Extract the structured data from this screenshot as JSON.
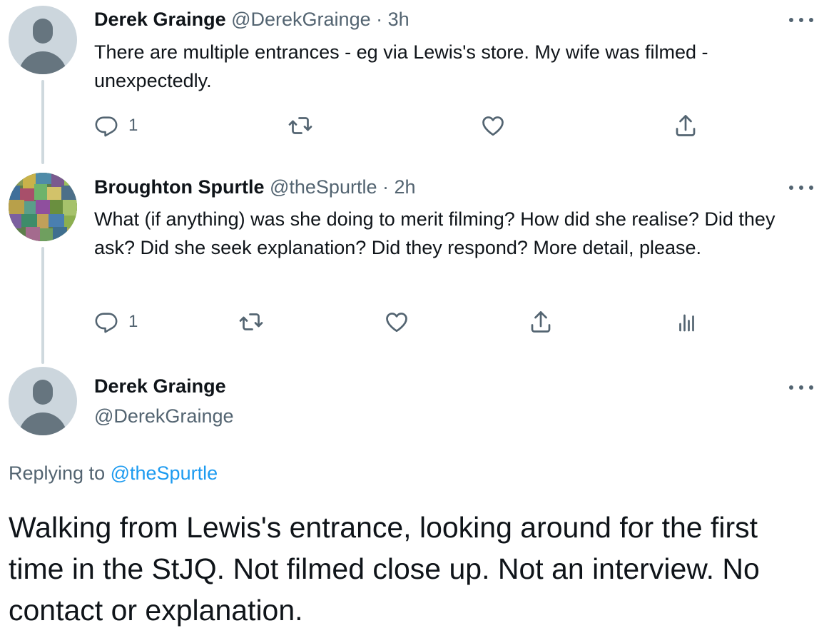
{
  "tweets": [
    {
      "author_name": "Derek Grainge",
      "handle": "@DerekGrainge",
      "separator": "·",
      "time": "3h",
      "text": "There are multiple entrances - eg via Lewis's store. My wife was filmed - unexpectedly.",
      "reply_count": "1",
      "avatar_icon": "default-profile-icon"
    },
    {
      "author_name": "Broughton Spurtle",
      "handle": "@theSpurtle",
      "separator": "·",
      "time": "2h",
      "text": "What (if anything) was she doing to merit filming? How did she realise? Did they ask? Did she seek explanation? Did they respond? More detail, please.",
      "reply_count": "1",
      "avatar_icon": "mosaic-profile-image"
    }
  ],
  "main_tweet": {
    "author_name": "Derek Grainge",
    "handle": "@DerekGrainge",
    "replying_prefix": "Replying to",
    "replying_to": "@theSpurtle",
    "text": "Walking from Lewis's entrance, looking around for the first time in the StJQ. Not filmed close up. Not an interview. No contact or explanation.",
    "avatar_icon": "default-profile-icon"
  },
  "colors": {
    "text": "#0f1419",
    "secondary": "#536471",
    "link": "#1d9bf0",
    "thread_line": "#cfd9de"
  },
  "icons": [
    "reply-icon",
    "retweet-icon",
    "like-icon",
    "share-icon",
    "analytics-icon",
    "more-icon"
  ]
}
